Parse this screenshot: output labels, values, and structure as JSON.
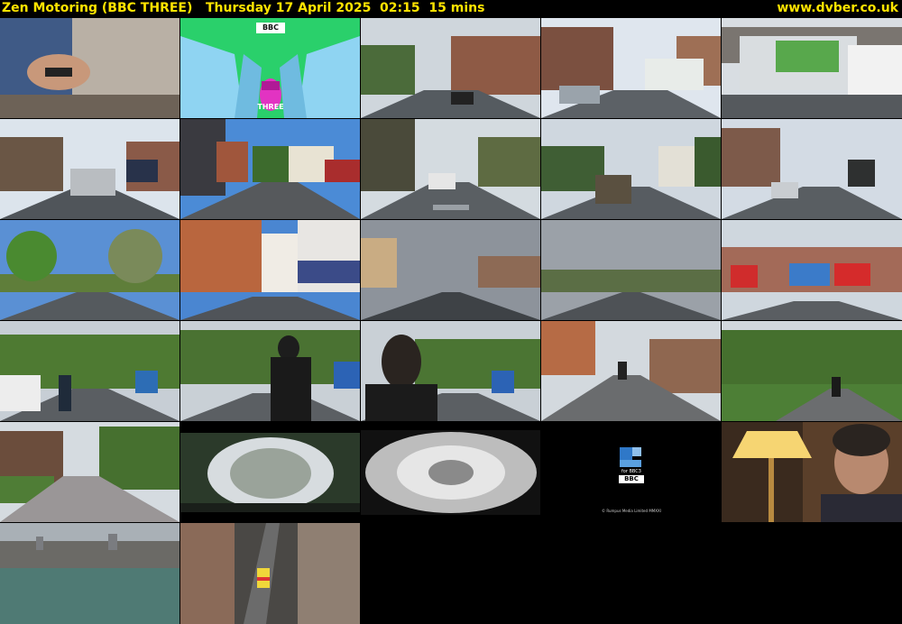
{
  "header": {
    "channel_title": "Zen Motoring (BBC THREE)",
    "datetime": "Thursday 17 April 2025  02:15  15 mins",
    "site": "www.dvber.co.uk"
  },
  "thumbnails": [
    {
      "index": 1,
      "scene": "hands holding phone",
      "time_text": ""
    },
    {
      "index": 2,
      "scene": "bbc three ident",
      "logo_text": "BBC",
      "caption": "THREE"
    },
    {
      "index": 3,
      "scene": "street driving",
      "time_text": ""
    },
    {
      "index": 4,
      "scene": "street with truck"
    },
    {
      "index": 5,
      "scene": "refuse lorry and van"
    },
    {
      "index": 6,
      "scene": "road with car ahead"
    },
    {
      "index": 7,
      "scene": "junction with pub"
    },
    {
      "index": 8,
      "scene": "road with slow marking"
    },
    {
      "index": 9,
      "scene": "residential road"
    },
    {
      "index": 10,
      "scene": "suburban road with lorry"
    },
    {
      "index": 11,
      "scene": "tree lined road"
    },
    {
      "index": 12,
      "scene": "brick buildings"
    },
    {
      "index": 13,
      "scene": "stormy sky road"
    },
    {
      "index": 14,
      "scene": "grey sky road"
    },
    {
      "index": 15,
      "scene": "shop parade"
    },
    {
      "index": 16,
      "scene": "cyclist road"
    },
    {
      "index": 17,
      "scene": "man in balaclava"
    },
    {
      "index": 18,
      "scene": "man close up"
    },
    {
      "index": 19,
      "scene": "flats and cyclist"
    },
    {
      "index": 20,
      "scene": "park path cyclist"
    },
    {
      "index": 21,
      "scene": "terraced houses"
    },
    {
      "index": 22,
      "scene": "tree canopy dome"
    },
    {
      "index": 23,
      "scene": "light tunnel"
    },
    {
      "index": 24,
      "scene": "production logo",
      "logo_text": "for BBC3",
      "bbc_text": "BBC",
      "copyright": "© Rumpus Media Limited MMXXI"
    },
    {
      "index": 25,
      "scene": "woman with lamp"
    },
    {
      "index": 26,
      "scene": "aerial city"
    },
    {
      "index": 27,
      "scene": "aerial street emergency vehicle"
    }
  ],
  "colors": {
    "header_text": "#ffe400",
    "background": "#000000"
  }
}
